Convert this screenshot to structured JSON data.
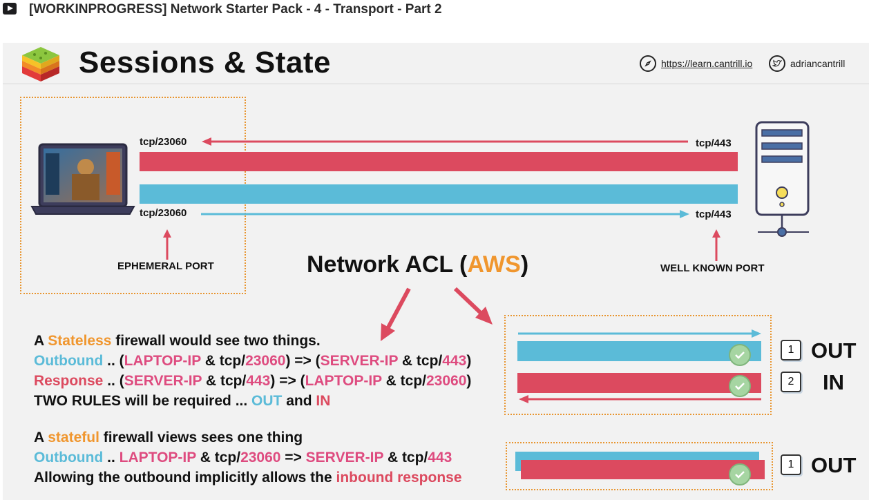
{
  "video": {
    "title": "[WORKINPROGRESS] Network Starter Pack - 4 - Transport - Part 2",
    "play_icon": "play-icon"
  },
  "slide": {
    "title": "Sessions & State",
    "website": "https://learn.cantrill.io",
    "twitter": "adriancantrill",
    "website_icon": "compass-icon",
    "twitter_icon": "twitter-bird-icon"
  },
  "diagram": {
    "top_left_port": "tcp/23060",
    "top_right_port": "tcp/443",
    "bottom_left_port": "tcp/23060",
    "bottom_right_port": "tcp/443",
    "ephemeral_label": "EPHEMERAL PORT",
    "well_known_label": "WELL KNOWN PORT",
    "acl_prefix": "Network ACL (",
    "acl_highlight": "AWS",
    "acl_suffix": ")"
  },
  "stateless": {
    "l1": [
      "A ",
      "Stateless",
      " firewall would see two things."
    ],
    "l2": [
      "Outbound",
      " .. (",
      "LAPTOP-IP",
      " & tcp/",
      "23060",
      ") => (",
      "SERVER-IP",
      " & tcp/",
      "443",
      ")"
    ],
    "l3": [
      "Response",
      " .. (",
      "SERVER-IP",
      " & tcp/",
      "443",
      ") => (",
      "LAPTOP-IP",
      " & tcp/",
      "23060",
      ")"
    ],
    "l4": [
      "TWO RULES will be required ... ",
      "OUT",
      " and ",
      "IN"
    ]
  },
  "stateful": {
    "l1": [
      "A ",
      "stateful",
      " firewall views sees one thing"
    ],
    "l2": [
      "Outbound",
      " .. ",
      "LAPTOP-IP",
      " & tcp/",
      "23060",
      " => ",
      "SERVER-IP",
      " & tcp/",
      "443"
    ],
    "l3": [
      "Allowing the outbound implicitly allows the ",
      "inbound response"
    ]
  },
  "rules": {
    "stateless": [
      {
        "num": "1",
        "dir": "OUT"
      },
      {
        "num": "2",
        "dir": "IN"
      }
    ],
    "stateful": [
      {
        "num": "1",
        "dir": "OUT"
      }
    ]
  },
  "colors": {
    "red": "#dc4a5f",
    "blue": "#5bbbd8",
    "orange": "#f0962e",
    "pink": "#de4b7f"
  }
}
